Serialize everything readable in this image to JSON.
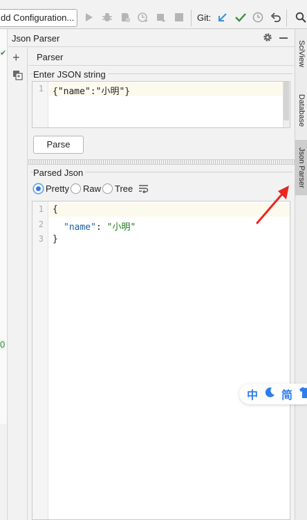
{
  "toolbar": {
    "config_label": "dd Configuration...",
    "git_label": "Git:"
  },
  "tool_window": {
    "title": "Json Parser",
    "tab": "Parser"
  },
  "input": {
    "group_label": "Enter JSON string",
    "line_numbers": [
      "1"
    ],
    "code_line_1": "{\"name\":\"小明\"}",
    "parse_button": "Parse"
  },
  "output": {
    "group_label": "Parsed Json",
    "format_options": [
      {
        "label": "Pretty",
        "selected": true
      },
      {
        "label": "Raw",
        "selected": false
      },
      {
        "label": "Tree",
        "selected": false
      }
    ],
    "line_numbers": [
      "1",
      "2",
      "3"
    ],
    "lines": {
      "l1": "{",
      "l2_key": "\"name\"",
      "l2_sep": ": ",
      "l2_val": "\"小明\"",
      "l3": "}"
    }
  },
  "right_stripe": {
    "tabs": [
      "SciView",
      "Database",
      "Json Parser"
    ],
    "active_tab": "Json Parser"
  },
  "left_gutter": {
    "marker_value": "0"
  },
  "ime_bar": {
    "lang": "中",
    "mode": "简"
  },
  "colors": {
    "accent": "#3574f0",
    "run_green": "#3d8c40",
    "git_blue": "#3a8fd9",
    "annotation_red": "#e8261f",
    "ime_blue": "#2e7dea"
  }
}
